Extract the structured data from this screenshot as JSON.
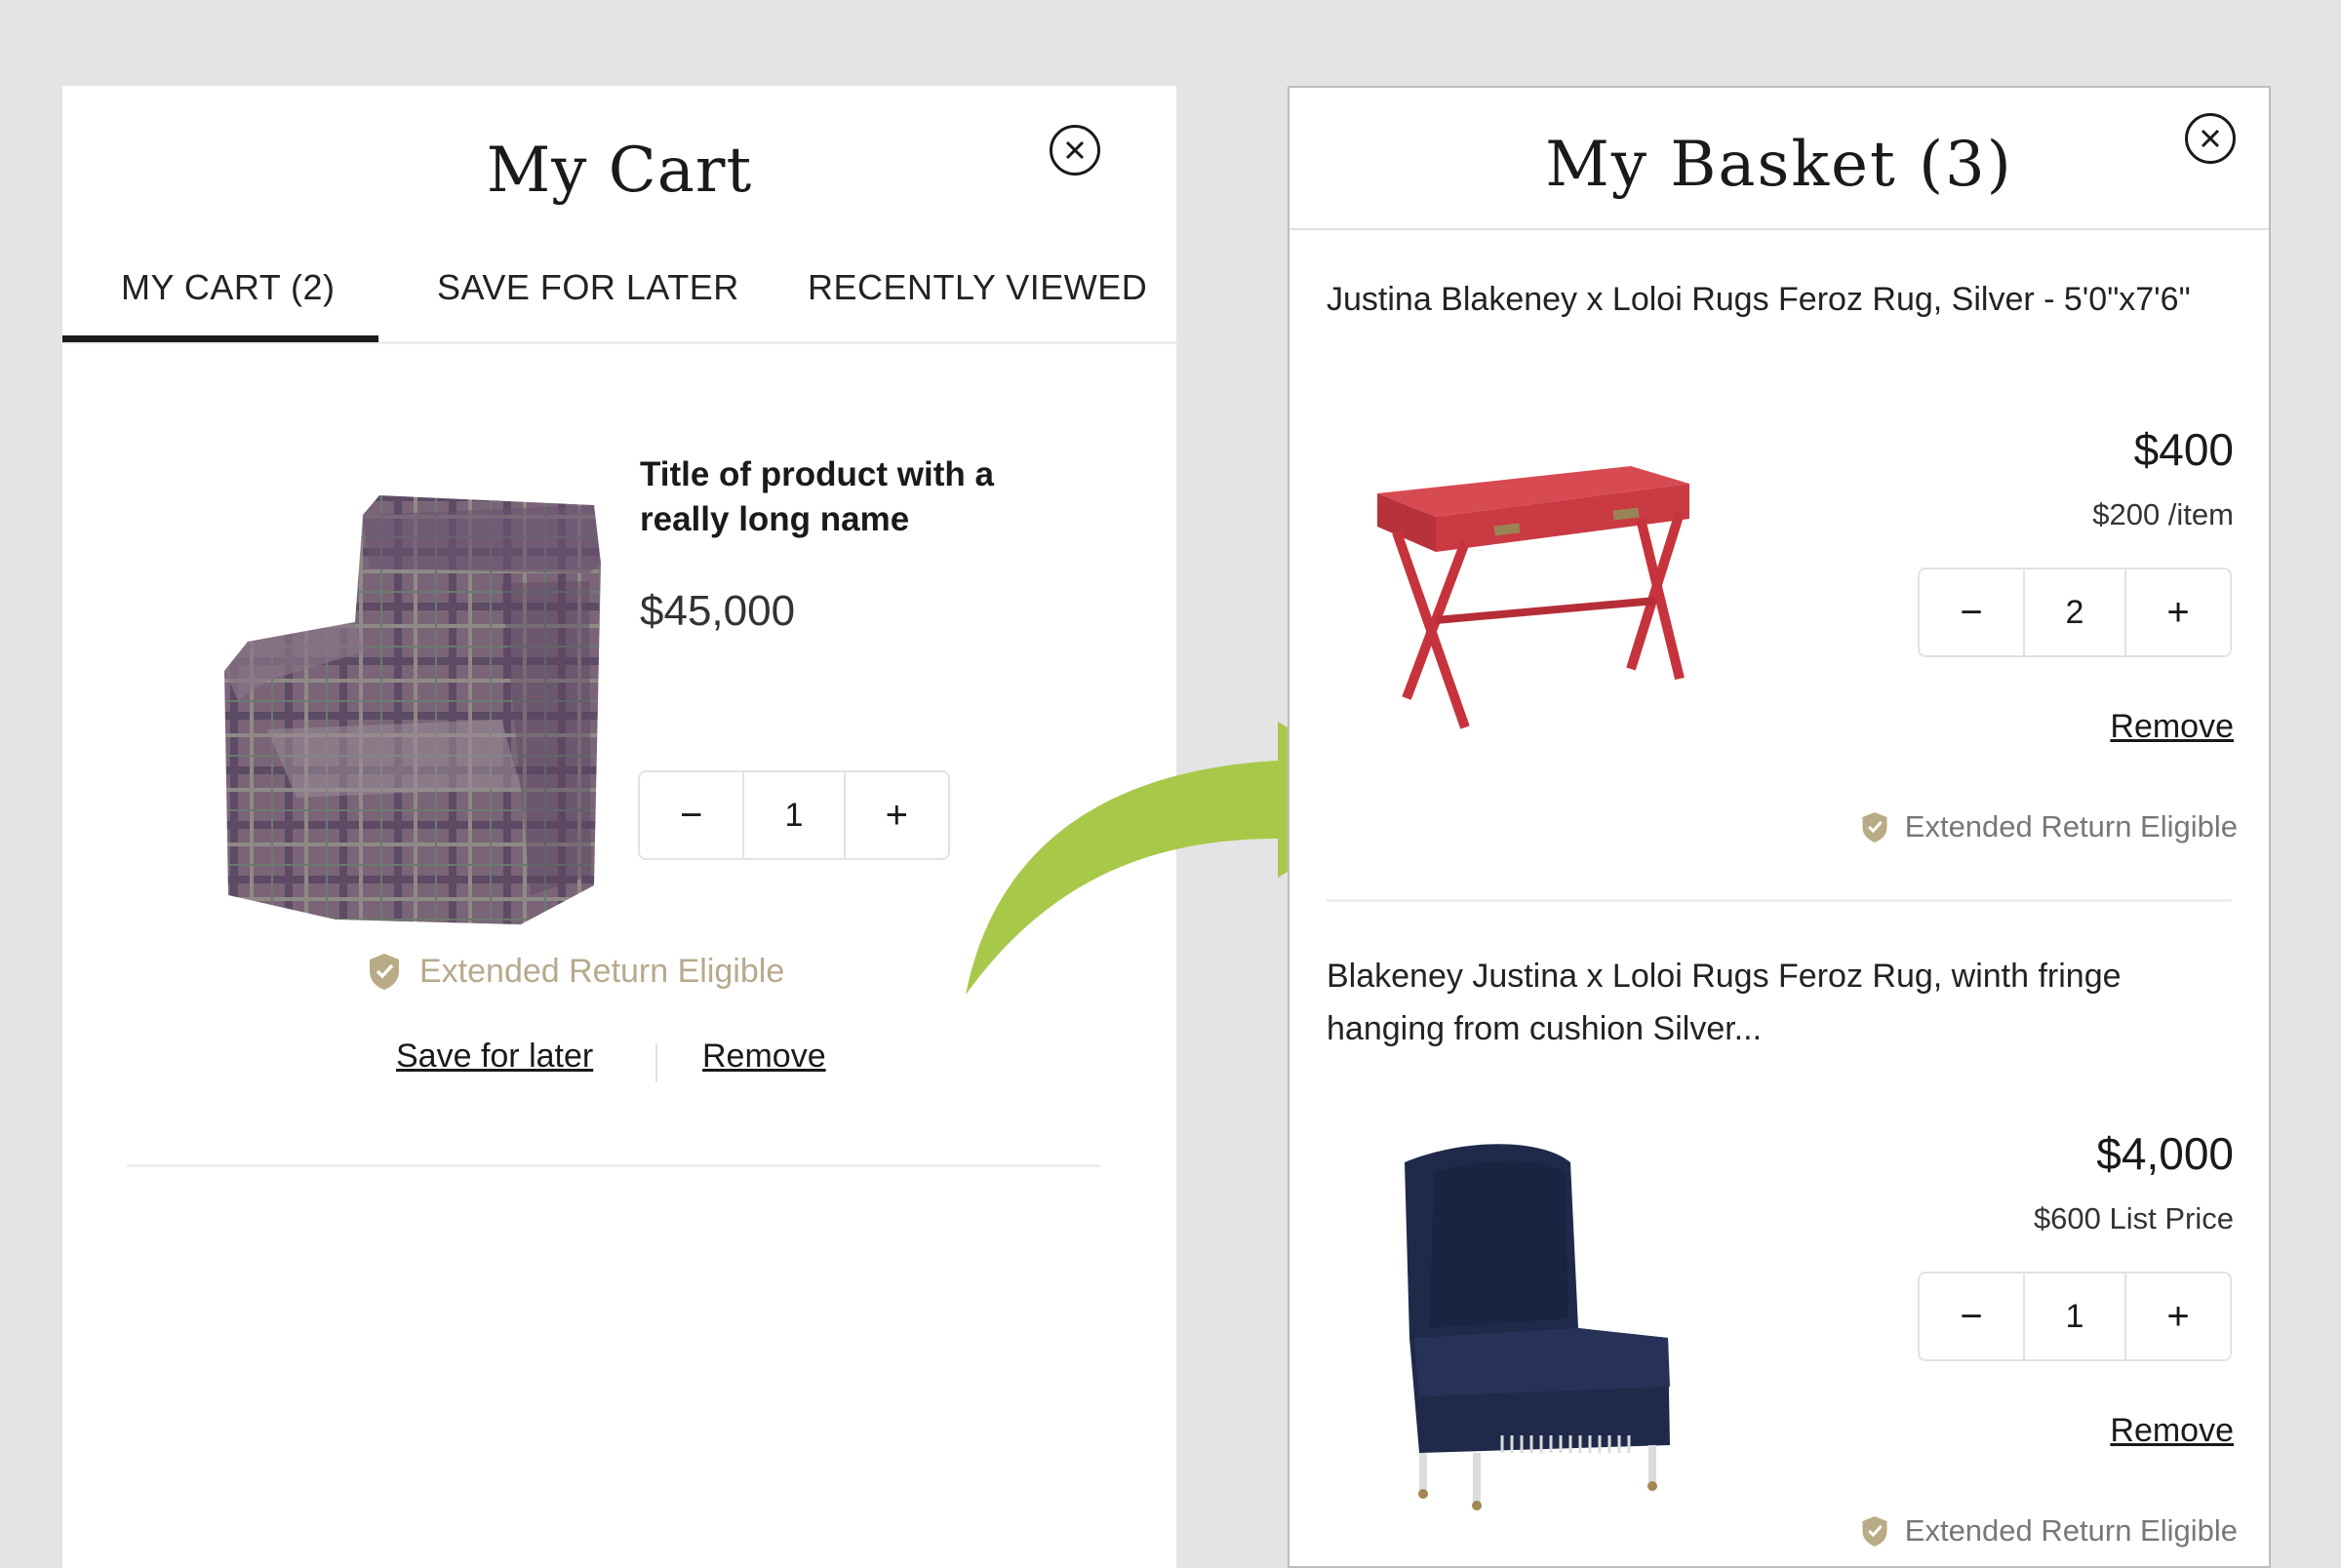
{
  "left_panel": {
    "title": "My Cart",
    "tabs": [
      {
        "label": "MY CART (2)",
        "active": true
      },
      {
        "label": "SAVE FOR LATER",
        "active": false
      },
      {
        "label": "RECENTLY VIEWED",
        "active": false
      }
    ],
    "item": {
      "title": "Title of product with a really long name",
      "price": "$45,000",
      "quantity": "1",
      "eligible_text": "Extended Return Eligible",
      "save_label": "Save for later",
      "remove_label": "Remove"
    }
  },
  "right_panel": {
    "title": "My Basket (3)",
    "items": [
      {
        "title": "Justina Blakeney x Loloi Rugs Feroz Rug, Silver - 5'0\"x7'6\"",
        "price": "$400",
        "sub_price": "$200 /item",
        "quantity": "2",
        "remove_label": "Remove",
        "eligible_text": "Extended Return Eligible"
      },
      {
        "title": "Blakeney Justina  x Loloi Rugs Feroz Rug, winth fringe hanging from cushion Silver...",
        "price": "$4,000",
        "sub_price": "$600 List Price",
        "quantity": "1",
        "remove_label": "Remove",
        "eligible_text": "Extended Return Eligible"
      }
    ]
  },
  "stepper": {
    "minus": "−",
    "plus": "+"
  },
  "colors": {
    "background": "#e4e4e4",
    "arrow": "#a8c84a",
    "eligible_gold": "#b7a98c",
    "shield": "#b9ab86"
  },
  "icons": [
    "close-icon",
    "shield-check-icon",
    "curved-arrow-icon"
  ]
}
